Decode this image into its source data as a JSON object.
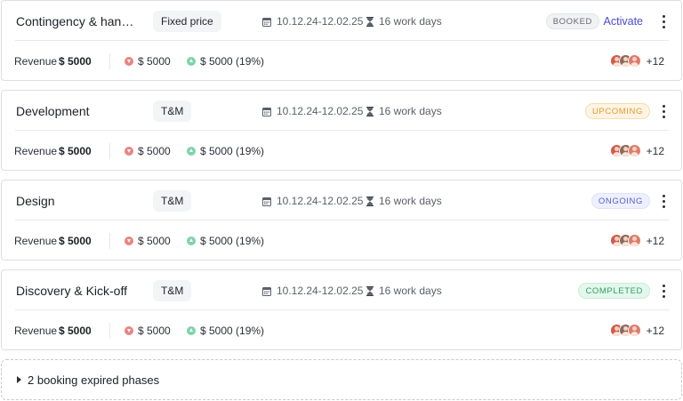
{
  "phases": [
    {
      "name": "Contingency & hand-...",
      "type": "Fixed price",
      "dates": "10.12.24-12.02.25",
      "duration": "16 work days",
      "status": "BOOKED",
      "action": "Activate",
      "revenue_label": "Revenue",
      "revenue": "$ 5000",
      "cost": "$ 5000",
      "margin": "$ 5000 (19%)",
      "team_extra": "+12"
    },
    {
      "name": "Development",
      "type": "T&M",
      "dates": "10.12.24-12.02.25",
      "duration": "16 work days",
      "status": "UPCOMING",
      "revenue_label": "Revenue",
      "revenue": "$ 5000",
      "cost": "$ 5000",
      "margin": "$ 5000 (19%)",
      "team_extra": "+12"
    },
    {
      "name": "Design",
      "type": "T&M",
      "dates": "10.12.24-12.02.25",
      "duration": "16 work days",
      "status": "ONGOING",
      "revenue_label": "Revenue",
      "revenue": "$ 5000",
      "cost": "$ 5000",
      "margin": "$ 5000 (19%)",
      "team_extra": "+12"
    },
    {
      "name": "Discovery & Kick-off",
      "type": "T&M",
      "dates": "10.12.24-12.02.25",
      "duration": "16 work days",
      "status": "COMPLETED",
      "revenue_label": "Revenue",
      "revenue": "$ 5000",
      "cost": "$ 5000",
      "margin": "$ 5000 (19%)",
      "team_extra": "+12"
    }
  ],
  "expired": {
    "label": "2 booking expired phases"
  },
  "colors": {
    "accent": "#4949d6",
    "booked": "#646a73",
    "upcoming": "#e39a34",
    "ongoing": "#5861c9",
    "completed": "#2e9f63",
    "cost_icon": "#e98480",
    "margin_icon": "#7dd3aa"
  },
  "icons": {
    "dates": "calendar-icon",
    "duration": "hourglass-icon",
    "cost": "arrow-down-circle-icon",
    "margin": "arrow-up-circle-icon",
    "menu": "kebab-menu-icon",
    "expand": "caret-right-icon"
  }
}
